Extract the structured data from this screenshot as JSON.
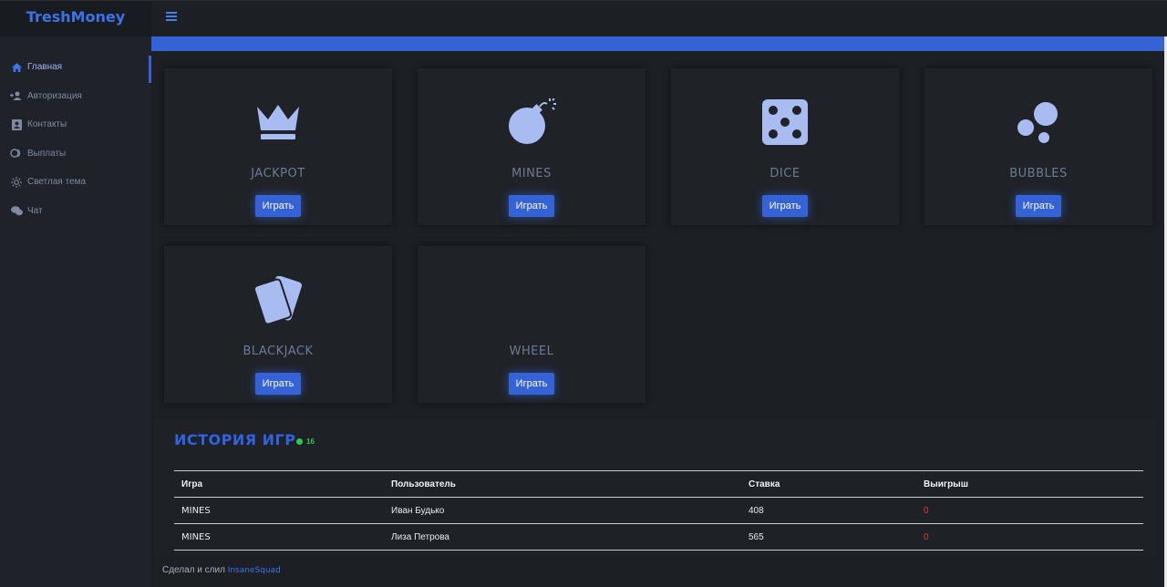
{
  "app": {
    "brand": "TreshMoney"
  },
  "sidebar": {
    "items": [
      {
        "label": "Главная",
        "icon": "home-icon",
        "active": true
      },
      {
        "label": "Авторизация",
        "icon": "user-plus-icon"
      },
      {
        "label": "Контакты",
        "icon": "contact-card-icon"
      },
      {
        "label": "Выплаты",
        "icon": "coins-icon"
      },
      {
        "label": "Светлая тема",
        "icon": "sun-icon"
      },
      {
        "label": "Чат",
        "icon": "chat-icon"
      }
    ]
  },
  "games": [
    {
      "title": "JACKPOT",
      "icon": "crown-icon",
      "button": "Играть"
    },
    {
      "title": "MINES",
      "icon": "bomb-icon",
      "button": "Играть"
    },
    {
      "title": "DICE",
      "icon": "dice-icon",
      "button": "Играть"
    },
    {
      "title": "BUBBLES",
      "icon": "bubbles-icon",
      "button": "Играть"
    },
    {
      "title": "BLACKJACK",
      "icon": "cards-icon",
      "button": "Играть"
    },
    {
      "title": "WHEEL",
      "icon": "",
      "button": "Играть"
    }
  ],
  "history": {
    "title": "ИСТОРИЯ ИГР",
    "online_count": "16",
    "columns": [
      "Игра",
      "Пользователь",
      "Ставка",
      "Выигрыш"
    ],
    "rows": [
      {
        "game": "MINES",
        "user": "Иван Будько",
        "bet": "408",
        "win": "0"
      },
      {
        "game": "MINES",
        "user": "Лиза Петрова",
        "bet": "565",
        "win": "0"
      }
    ]
  },
  "footer": {
    "text": "Сделал и слил",
    "link": "InsaneSquad"
  },
  "colors": {
    "accent": "#3563d6",
    "brand": "#3d73e8",
    "online": "#2dc84d",
    "loss": "#e03a3a"
  }
}
